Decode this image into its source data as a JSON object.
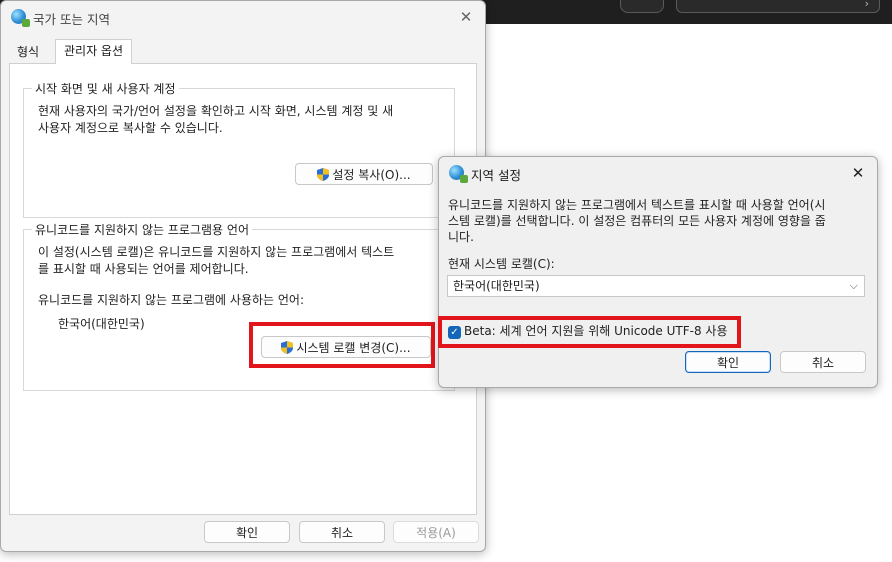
{
  "background": {
    "search_arrow": "›"
  },
  "main_dialog": {
    "title": "국가 또는 지역",
    "close_glyph": "✕",
    "tabs": [
      "형식",
      "관리자 옵션"
    ],
    "group1": {
      "label": "시작 화면 및 새 사용자 계정",
      "desc_line1": "현재 사용자의 국가/언어 설정을 확인하고 시작 화면, 시스템 계정 및 새",
      "desc_line2": "사용자 계정으로 복사할 수 있습니다.",
      "copy_button": "설정 복사(O)..."
    },
    "group2": {
      "label": "유니코드를 지원하지 않는 프로그램용 언어",
      "desc_line1": "이 설정(시스템 로캘)은 유니코드를 지원하지 않는 프로그램에서 텍스트",
      "desc_line2": "를 표시할 때 사용되는 언어를 제어합니다.",
      "current_label": "유니코드를 지원하지 않는 프로그램에 사용하는 언어:",
      "current_value": "한국어(대한민국)",
      "change_button": "시스템 로캘 변경(C)..."
    },
    "footer": {
      "ok": "확인",
      "cancel": "취소",
      "apply": "적용(A)"
    }
  },
  "locale_dialog": {
    "title": "지역 설정",
    "close_glyph": "✕",
    "desc_line1": "유니코드를 지원하지 않는 프로그램에서 텍스트를 표시할 때 사용할 언어(시",
    "desc_line2": "스템 로캘)를 선택합니다. 이 설정은 컴퓨터의 모든 사용자 계정에 영향을 줍",
    "desc_line3": "니다.",
    "locale_label": "현재 시스템 로캘(C):",
    "locale_value": "한국어(대한민국)",
    "chevron": "⌵",
    "beta_checkbox_label": "Beta: 세계 언어 지원을 위해 Unicode UTF-8 사용",
    "beta_checked": true,
    "check_glyph": "✓",
    "ok": "확인",
    "cancel": "취소"
  },
  "colors": {
    "highlight": "#e1151b",
    "accent": "#1466b8"
  },
  "icons": [
    "globe-icon",
    "shield-icon",
    "close-icon",
    "chevron-down-icon",
    "checkmark-icon"
  ]
}
